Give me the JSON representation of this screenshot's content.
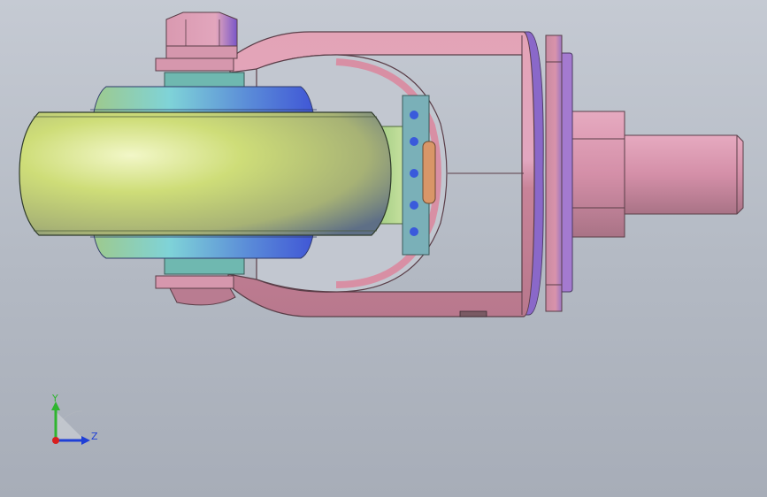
{
  "viewport": {
    "background_top": "#c5cad3",
    "background_bottom": "#a7adb8"
  },
  "model": {
    "wheel_color": "#c9d977",
    "hub_color": "#6fb8c9",
    "fork_color": "#d38ea3",
    "plate_color": "#c98aa8",
    "bearing_color": "#b7d48a"
  },
  "triad": {
    "y_label": "Y",
    "z_label": "Z",
    "y_color": "#2fb52f",
    "z_color": "#1f3fd6",
    "x_color": "#d81f1f"
  }
}
